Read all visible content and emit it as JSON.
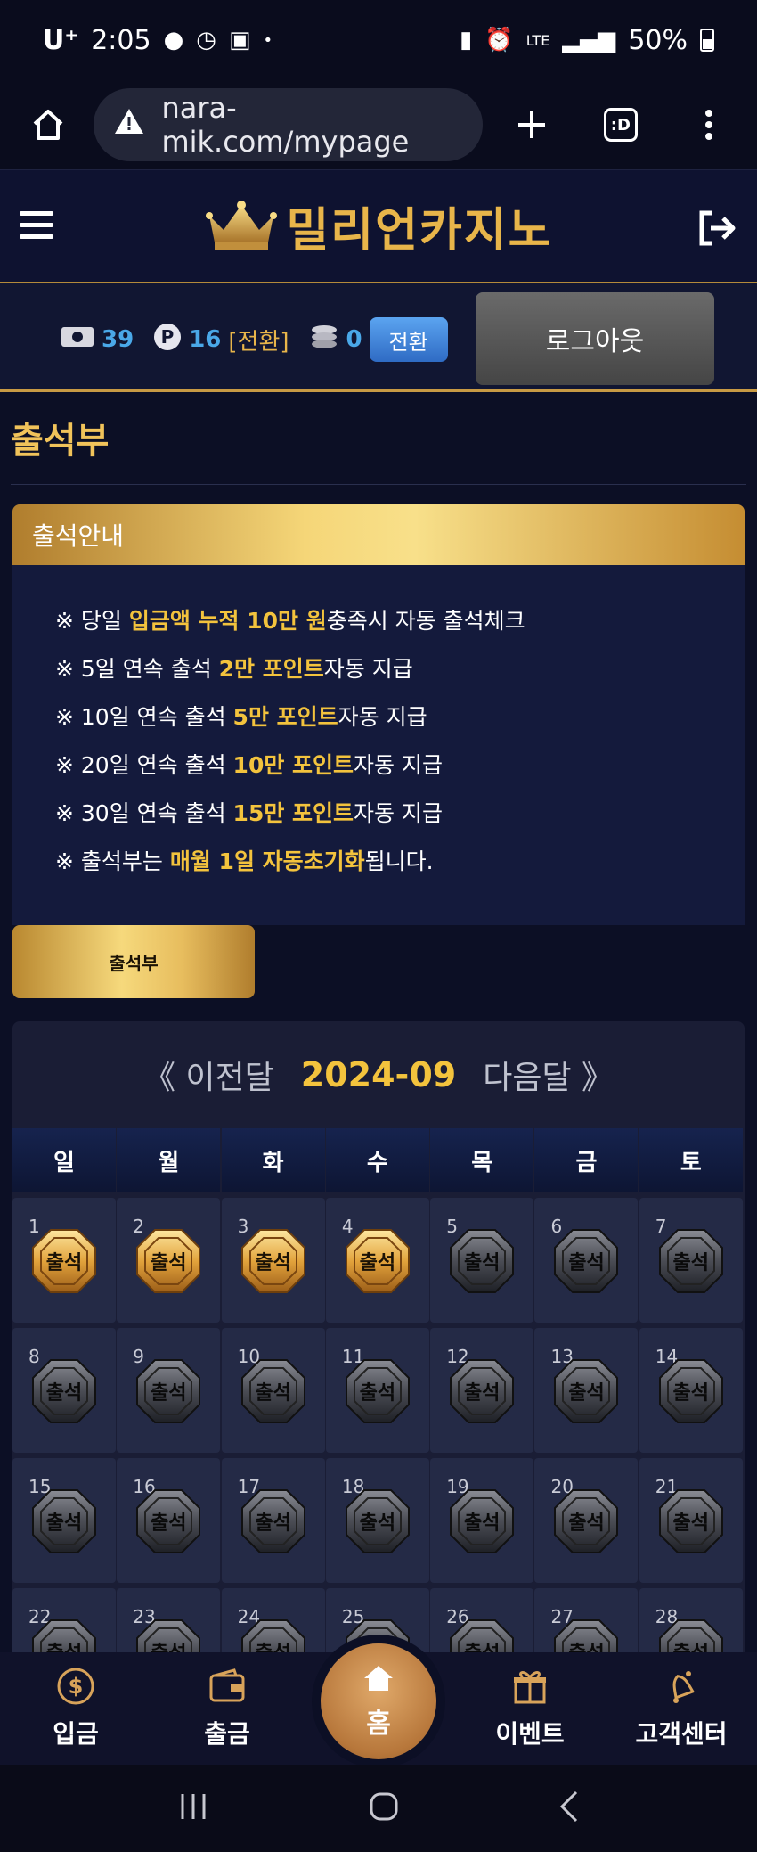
{
  "status_bar": {
    "carrier": "U⁺",
    "time": "2:05",
    "network": "LTE",
    "battery": "50%"
  },
  "browser": {
    "url": "nara-mik.com/mypage",
    "tab_count": ":D"
  },
  "site": {
    "logo_text": "밀리언카지노"
  },
  "user_bar": {
    "cash": "39",
    "points": "16",
    "points_convert_link": "[전환]",
    "coins": "0",
    "convert_button": "전환",
    "logout_button": "로그아웃"
  },
  "page": {
    "title": "출석부"
  },
  "notice": {
    "header": "출석안내",
    "lines": [
      {
        "pre": "※ 당일 ",
        "hl": "입금액 누적 10만 원",
        "post": "충족시 자동 출석체크"
      },
      {
        "pre": "※ 5일 연속 출석 ",
        "hl": "2만 포인트",
        "post": "자동 지급"
      },
      {
        "pre": "※ 10일 연속 출석 ",
        "hl": "5만 포인트",
        "post": "자동 지급"
      },
      {
        "pre": "※ 20일 연속 출석 ",
        "hl": "10만 포인트",
        "post": "자동 지급"
      },
      {
        "pre": "※ 30일 연속 출석 ",
        "hl": "15만 포인트",
        "post": "자동 지급"
      },
      {
        "pre": "※ 출석부는 ",
        "hl": "매월 1일 자동초기화",
        "post": "됩니다."
      }
    ]
  },
  "attendance_tab": "출석부",
  "calendar": {
    "prev": "《 이전달",
    "month": "2024-09",
    "next": "다음달 》",
    "weekdays": [
      "일",
      "월",
      "화",
      "수",
      "목",
      "금",
      "토"
    ],
    "badge_label": "출석",
    "days": [
      {
        "n": "1",
        "attended": true
      },
      {
        "n": "2",
        "attended": true
      },
      {
        "n": "3",
        "attended": true
      },
      {
        "n": "4",
        "attended": true
      },
      {
        "n": "5",
        "attended": false
      },
      {
        "n": "6",
        "attended": false
      },
      {
        "n": "7",
        "attended": false
      },
      {
        "n": "8",
        "attended": false
      },
      {
        "n": "9",
        "attended": false
      },
      {
        "n": "10",
        "attended": false
      },
      {
        "n": "11",
        "attended": false
      },
      {
        "n": "12",
        "attended": false
      },
      {
        "n": "13",
        "attended": false
      },
      {
        "n": "14",
        "attended": false
      },
      {
        "n": "15",
        "attended": false
      },
      {
        "n": "16",
        "attended": false
      },
      {
        "n": "17",
        "attended": false
      },
      {
        "n": "18",
        "attended": false
      },
      {
        "n": "19",
        "attended": false
      },
      {
        "n": "20",
        "attended": false
      },
      {
        "n": "21",
        "attended": false
      },
      {
        "n": "22",
        "attended": false
      },
      {
        "n": "23",
        "attended": false
      },
      {
        "n": "24",
        "attended": false
      },
      {
        "n": "25",
        "attended": false
      },
      {
        "n": "26",
        "attended": false
      },
      {
        "n": "27",
        "attended": false
      },
      {
        "n": "28",
        "attended": false
      }
    ]
  },
  "bottom_nav": {
    "deposit": "입금",
    "withdraw": "출금",
    "home": "홈",
    "event": "이벤트",
    "support": "고객센터"
  }
}
